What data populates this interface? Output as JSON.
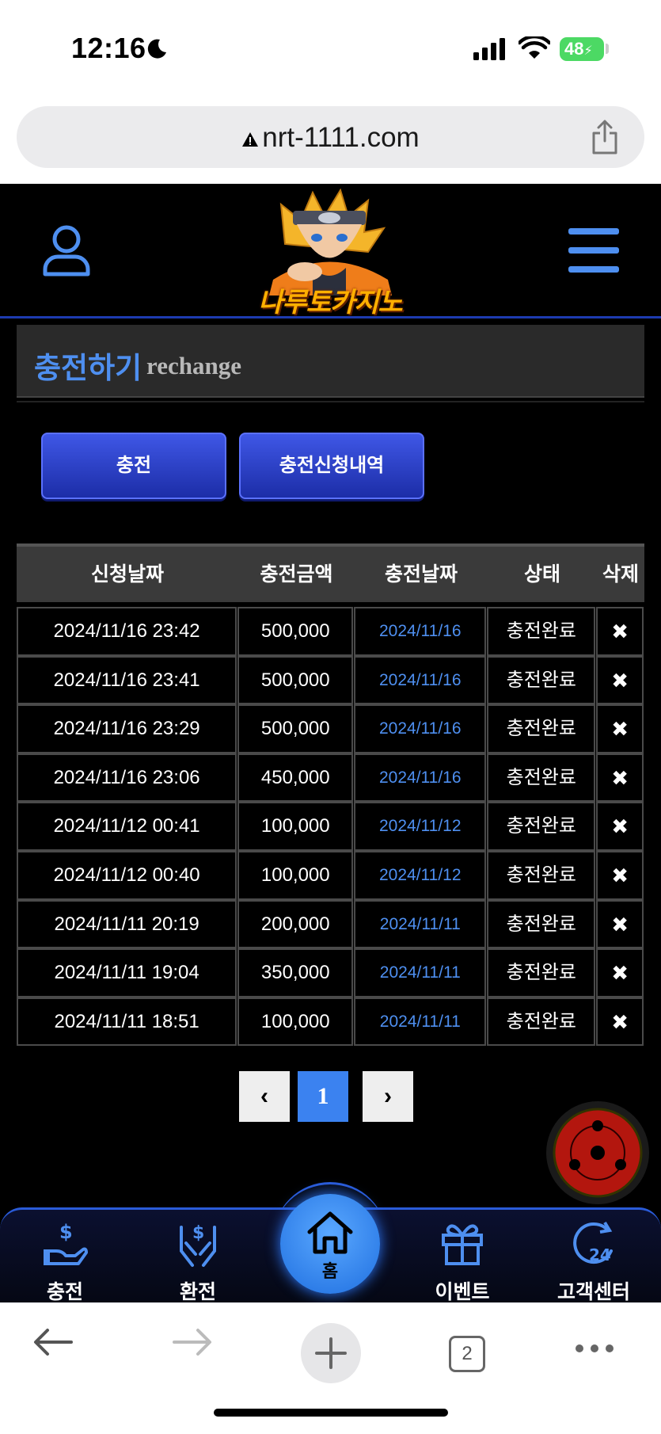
{
  "status_bar": {
    "time": "12:16",
    "battery": "48"
  },
  "browser": {
    "url": "nrt-1111.com",
    "tab_count": "2"
  },
  "site": {
    "logo_text": "나루토카지노"
  },
  "page": {
    "title_kr": "충전하기",
    "title_en": "rechange"
  },
  "buttons": {
    "charge": "충전",
    "history": "충전신청내역"
  },
  "table": {
    "headers": [
      "신청날짜",
      "충전금액",
      "충전날짜",
      "상태",
      "삭제"
    ],
    "rows": [
      [
        "2024/11/16 23:42",
        "500,000",
        "2024/11/16",
        "충전완료",
        "✖"
      ],
      [
        "2024/11/16 23:41",
        "500,000",
        "2024/11/16",
        "충전완료",
        "✖"
      ],
      [
        "2024/11/16 23:29",
        "500,000",
        "2024/11/16",
        "충전완료",
        "✖"
      ],
      [
        "2024/11/16 23:06",
        "450,000",
        "2024/11/16",
        "충전완료",
        "✖"
      ],
      [
        "2024/11/12 00:41",
        "100,000",
        "2024/11/12",
        "충전완료",
        "✖"
      ],
      [
        "2024/11/12 00:40",
        "100,000",
        "2024/11/12",
        "충전완료",
        "✖"
      ],
      [
        "2024/11/11 20:19",
        "200,000",
        "2024/11/11",
        "충전완료",
        "✖"
      ],
      [
        "2024/11/11 19:04",
        "350,000",
        "2024/11/11",
        "충전완료",
        "✖"
      ],
      [
        "2024/11/11 18:51",
        "100,000",
        "2024/11/11",
        "충전완료",
        "✖"
      ]
    ]
  },
  "pagination": {
    "prev": "‹",
    "current": "1",
    "next": "›"
  },
  "bottom_nav": {
    "charge": "충전",
    "exchange": "환전",
    "home": "홈",
    "event": "이벤트",
    "support": "고객센터",
    "support_badge": "24"
  },
  "colors": {
    "accent": "#4e8ff0",
    "button": "#2a3fd0",
    "nav_border": "#2a5bd8"
  }
}
